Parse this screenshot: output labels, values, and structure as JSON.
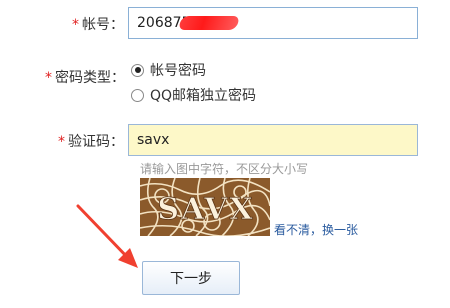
{
  "account": {
    "star": "*",
    "label": "帐号：",
    "value": "206875"
  },
  "password_type": {
    "star": "*",
    "label": "密码类型：",
    "options": [
      {
        "label": "帐号密码",
        "checked": true
      },
      {
        "label": "QQ邮箱独立密码",
        "checked": false
      }
    ]
  },
  "verify": {
    "star": "*",
    "label": "验证码：",
    "value": "savx",
    "hint": "请输入图中字符，不区分大小写",
    "captcha_text": "SAVX",
    "refresh_link": "看不清，换一张"
  },
  "next_button": "下一步",
  "colors": {
    "required_star": "#e02020",
    "input_border": "#8ab0d6",
    "captcha_bg": "#fdf8c8",
    "arrow": "#f04030",
    "link": "#2a5b9f"
  }
}
